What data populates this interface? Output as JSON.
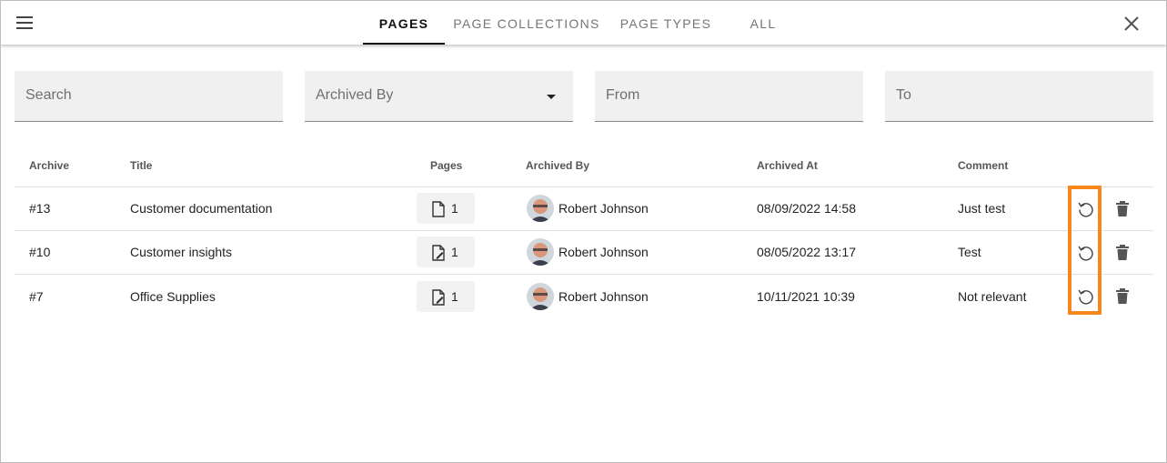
{
  "topbar": {
    "tabs": [
      {
        "label": "PAGES",
        "active": true
      },
      {
        "label": "PAGE COLLECTIONS",
        "active": false
      },
      {
        "label": "PAGE TYPES",
        "active": false
      },
      {
        "label": "ALL",
        "active": false
      }
    ],
    "menu_icon": "hamburger-menu-icon",
    "close_icon": "close-icon"
  },
  "filters": {
    "search_placeholder": "Search",
    "archived_by_placeholder": "Archived By",
    "from_placeholder": "From",
    "to_placeholder": "To"
  },
  "table": {
    "headers": {
      "archive": "Archive",
      "title": "Title",
      "pages": "Pages",
      "archived_by": "Archived By",
      "archived_at": "Archived At",
      "comment": "Comment"
    },
    "rows": [
      {
        "archive": "#13",
        "title": "Customer documentation",
        "pages": "1",
        "archived_by": "Robert Johnson",
        "archived_at": "08/09/2022 14:58",
        "comment": "Just test"
      },
      {
        "archive": "#10",
        "title": "Customer insights",
        "pages": "1",
        "archived_by": "Robert Johnson",
        "archived_at": "08/05/2022 13:17",
        "comment": "Test"
      },
      {
        "archive": "#7",
        "title": "Office Supplies",
        "pages": "1",
        "archived_by": "Robert Johnson",
        "archived_at": "10/11/2021 10:39",
        "comment": "Not relevant"
      }
    ]
  },
  "colors": {
    "highlight": "#f7871b",
    "field_bg": "#f0f0f0",
    "active_tab": "#111111"
  }
}
